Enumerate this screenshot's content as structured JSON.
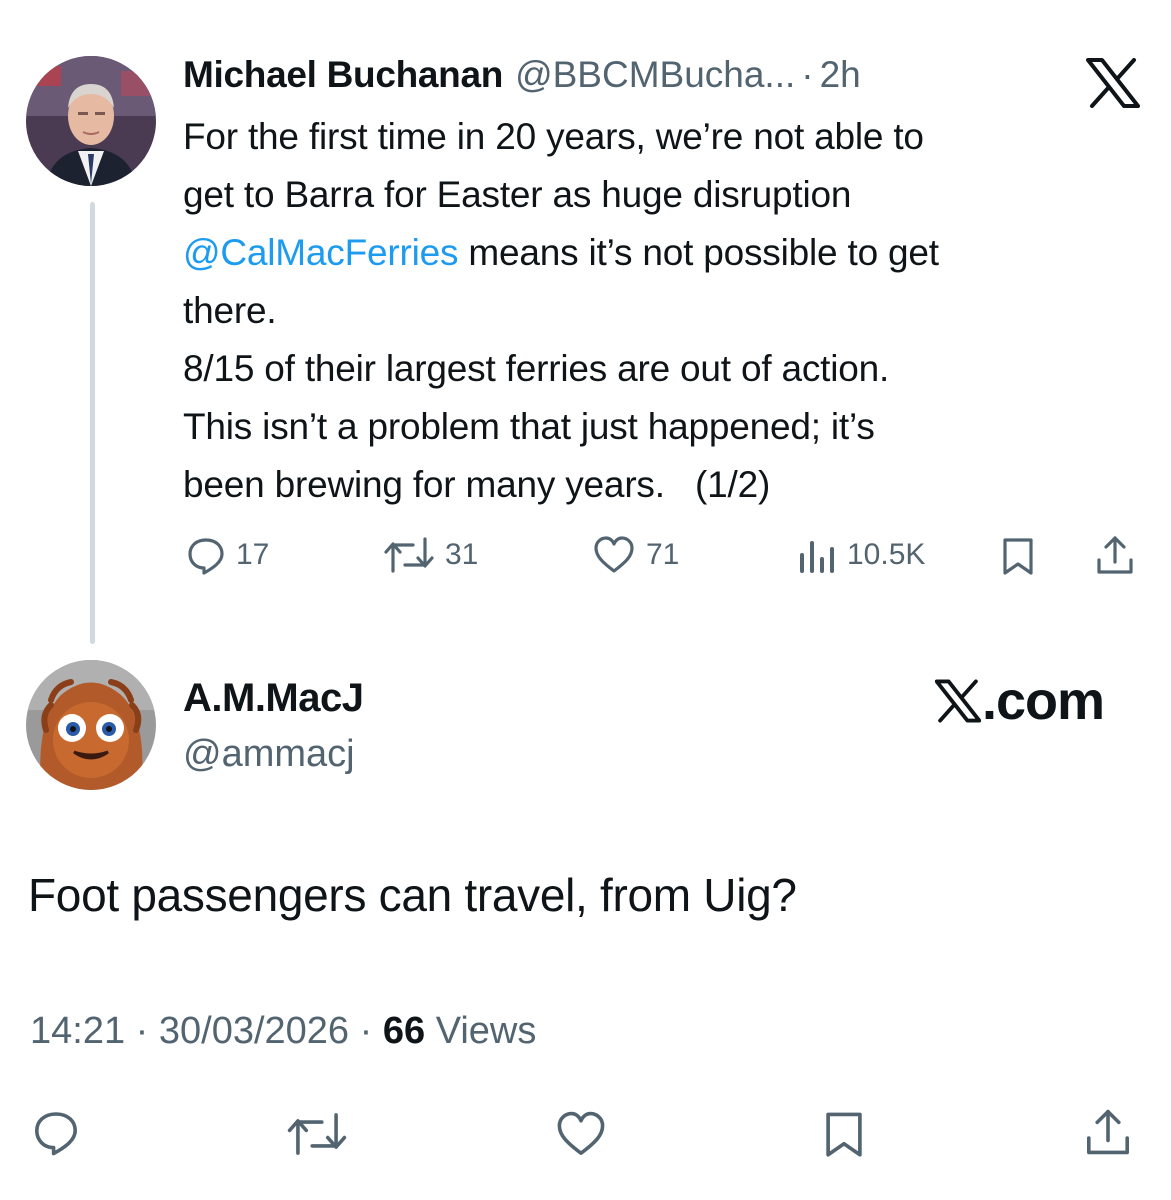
{
  "tweet1": {
    "author_name": "Michael Buchanan",
    "handle": "@BBCMBucha...",
    "separator": "·",
    "age": "2h",
    "logo_icon": "x-logo-icon",
    "text_lines": [
      {
        "before": "For the first time in 20 years, we’re not able to",
        "mention": "",
        "after": ""
      },
      {
        "before": "get to Barra for Easter as huge disruption",
        "mention": "",
        "after": ""
      },
      {
        "before": "",
        "mention": "@CalMacFerries",
        "after": " means it’s not possible to get"
      },
      {
        "before": "there.",
        "mention": "",
        "after": ""
      },
      {
        "before": "8/15 of their largest ferries are out of action.",
        "mention": "",
        "after": ""
      },
      {
        "before": "This isn’t a problem that just happened; it’s",
        "mention": "",
        "after": ""
      },
      {
        "before": "been brewing for many years.   (1/2)",
        "mention": "",
        "after": ""
      }
    ],
    "actions": {
      "replies": "17",
      "reposts": "31",
      "likes": "71",
      "views": "10.5K"
    }
  },
  "tweet2": {
    "author_name": "A.M.MacJ",
    "handle": "@ammacj",
    "site_label": ".com",
    "text": "Foot passengers can travel, from Uig?",
    "time": "14:21",
    "separator": "·",
    "date": "30/03/2026",
    "views_count": "66",
    "views_label": "Views"
  },
  "colors": {
    "text": "#0f1419",
    "secondary": "#536471",
    "link": "#1d9bf0",
    "thread_line": "#cfd9de"
  }
}
